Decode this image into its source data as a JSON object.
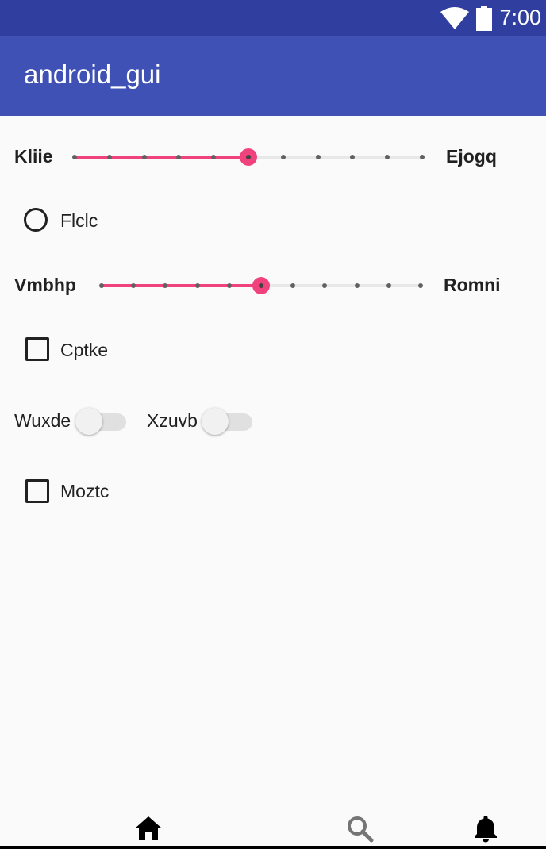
{
  "status_bar": {
    "time": "7:00",
    "icons": [
      "wifi-icon",
      "battery-icon"
    ],
    "background": "#303f9f"
  },
  "app_bar": {
    "title": "android_gui",
    "background": "#3f51b5"
  },
  "accent_color": "#f0437e",
  "seekbar_1": {
    "label_left": "Kliie",
    "label_right": "Ejogq",
    "ticks": 11,
    "value_index": 5
  },
  "radio_1": {
    "label": "Flclc",
    "checked": false
  },
  "seekbar_2": {
    "label_left": "Vmbhp",
    "label_right": "Romni",
    "ticks": 11,
    "value_index": 5
  },
  "checkbox_1": {
    "label": "Cptke",
    "checked": false
  },
  "switch_1": {
    "label": "Wuxde",
    "on": false
  },
  "switch_2": {
    "label": "Xzuvb",
    "on": false
  },
  "checkbox_2": {
    "label": "Moztc",
    "checked": false
  },
  "bottom_nav": {
    "items": [
      {
        "icon": "home-icon",
        "color": "#000000"
      },
      {
        "icon": "search-icon",
        "color": "#757575"
      },
      {
        "icon": "bell-icon",
        "color": "#000000"
      }
    ]
  }
}
